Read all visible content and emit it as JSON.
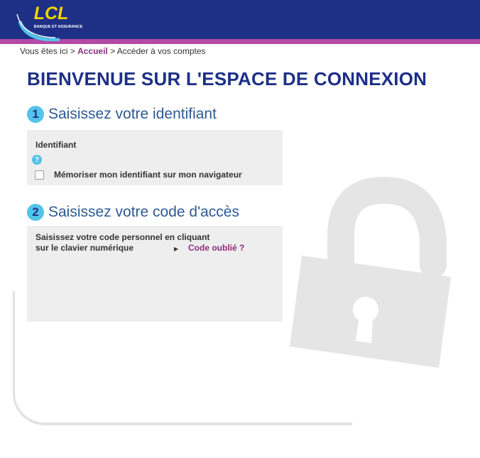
{
  "header": {
    "logo_text": "LCL",
    "logo_subtitle": "BANQUE ET ASSURANCE"
  },
  "breadcrumb": {
    "prefix": "Vous êtes ici",
    "sep1": ">",
    "home": "Accueil",
    "sep2": ">",
    "current": "Accéder à vos comptes"
  },
  "page_title": "BIENVENUE SUR L'ESPACE DE CONNEXION",
  "step1": {
    "number": "1",
    "title": "Saisissez votre identifiant",
    "field_label": "Identifiant",
    "help": "?",
    "remember_label": "Mémoriser mon identifiant sur mon navigateur"
  },
  "step2": {
    "number": "2",
    "title": "Saisissez votre code d'accès",
    "instruction_line1": "Saisissez votre code personnel en cliquant",
    "instruction_line2": "sur le clavier numérique",
    "forgot_link": "Code oublié ?"
  },
  "icons": {
    "arrow": "arrow-right-icon",
    "help": "help-icon",
    "lock": "padlock-icon"
  },
  "colors": {
    "header_bg": "#1e3086",
    "stripe": "#b24aa6",
    "accent_blue": "#54c3ea",
    "link_purple": "#8a2f7e",
    "logo_yellow": "#f2d100"
  }
}
